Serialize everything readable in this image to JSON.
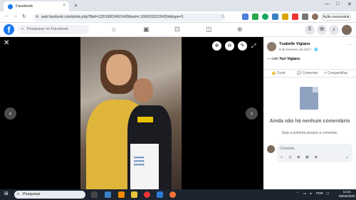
{
  "browser": {
    "tab_title": "Facebook",
    "tab_close": "×",
    "new_tab": "+",
    "url": "web.facebook.com/photo.php?fbid=1155196014601428&set=t.100003331204354&type=3",
    "update_button": "Ação necessária",
    "window_controls": [
      "—",
      "□",
      "✕"
    ]
  },
  "facebook": {
    "logo": "f",
    "search_placeholder": "Pesquisar no Facebook"
  },
  "viewer": {
    "close": "✕",
    "prev": "‹",
    "next": "›",
    "photo_description": "",
    "hearts": "♥♥♥♥♥ ♥♥♥♥♥ ♥♥♥♥♥"
  },
  "post": {
    "author": "Ysabelle Vigiano",
    "date": "8 de fevereiro de 2017 · 🌐",
    "more": "···",
    "with_prefix": "— com",
    "with_name": "Yuri Vigiano",
    "like": "Curtir",
    "comment": "Comentar",
    "share": "Compartilhar",
    "empty_title": "Ainda não há nenhum comentário",
    "empty_sub": "Seja a primeira pessoa a comentar.",
    "comment_placeholder": "Comente...",
    "comment_icons": "☺ ◎ ◉ ▣ ☻",
    "send": "➤"
  },
  "taskbar": {
    "search_label": "Pesquisar",
    "lang": "POR",
    "time": "14:21",
    "date": "09/05/2020"
  },
  "colors": {
    "fb_blue": "#1877f2",
    "viewer_bg": "#000000",
    "taskbar_bg": "#1c2430"
  }
}
